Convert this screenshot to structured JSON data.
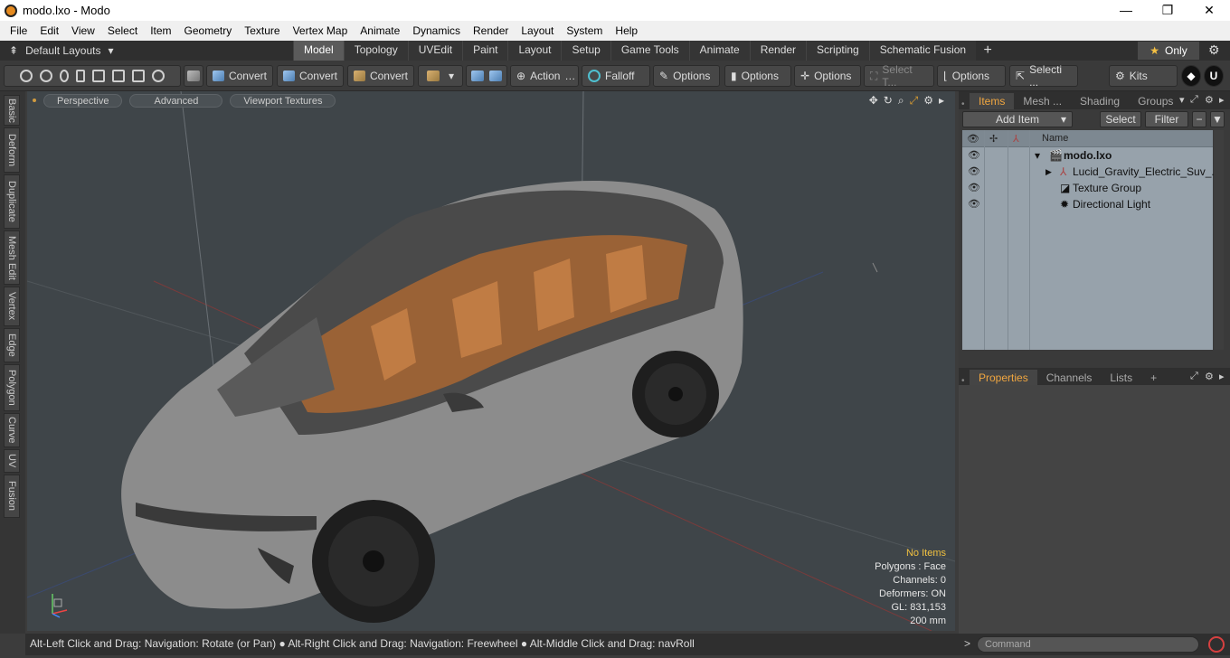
{
  "window": {
    "title": "modo.lxo - Modo",
    "min": "—",
    "max": "❐",
    "close": "✕"
  },
  "menu": [
    "File",
    "Edit",
    "View",
    "Select",
    "Item",
    "Geometry",
    "Texture",
    "Vertex Map",
    "Animate",
    "Dynamics",
    "Render",
    "Layout",
    "System",
    "Help"
  ],
  "layouts": {
    "label": "Default Layouts"
  },
  "tabs": [
    "Model",
    "Topology",
    "UVEdit",
    "Paint",
    "Layout",
    "Setup",
    "Game Tools",
    "Animate",
    "Render",
    "Scripting",
    "Schematic Fusion"
  ],
  "only_label": "Only",
  "toolbar": {
    "convert1": "Convert",
    "convert2": "Convert",
    "convert3": "Convert",
    "action": "Action",
    "falloff": "Falloff",
    "options1": "Options",
    "options2": "Options",
    "options3": "Options",
    "options4": "Options",
    "select_t": "Select T...",
    "selecti": "Selecti ...",
    "kits": "Kits"
  },
  "side_tabs": [
    "Basic",
    "Deform",
    "Duplicate",
    "Mesh Edit",
    "Vertex",
    "Edge",
    "Polygon",
    "Curve",
    "UV",
    "Fusion"
  ],
  "viewport": {
    "perspective": "Perspective",
    "advanced": "Advanced",
    "textures": "Viewport Textures",
    "stats": {
      "no_items": "No Items",
      "polygons": "Polygons : Face",
      "channels": "Channels: 0",
      "deformers": "Deformers: ON",
      "gl": "GL: 831,153",
      "size": "200 mm"
    }
  },
  "status": "Alt-Left Click and Drag: Navigation: Rotate (or Pan) ● Alt-Right Click and Drag: Navigation: Freewheel ● Alt-Middle Click and Drag: navRoll",
  "items_panel": {
    "tabs": [
      "Items",
      "Mesh ...",
      "Shading",
      "Groups"
    ],
    "add_item": "Add Item",
    "select": "Select",
    "filter": "Filter",
    "col_name": "Name",
    "rows": [
      "modo.lxo",
      "Lucid_Gravity_Electric_Suv_...",
      "Texture Group",
      "Directional Light"
    ]
  },
  "props_panel": {
    "tabs": [
      "Properties",
      "Channels",
      "Lists"
    ]
  },
  "command": {
    "placeholder": "Command"
  },
  "colors": {
    "accent": "#f0a640",
    "viewport_bg": "#3f4549",
    "interior": "#b0703a"
  }
}
